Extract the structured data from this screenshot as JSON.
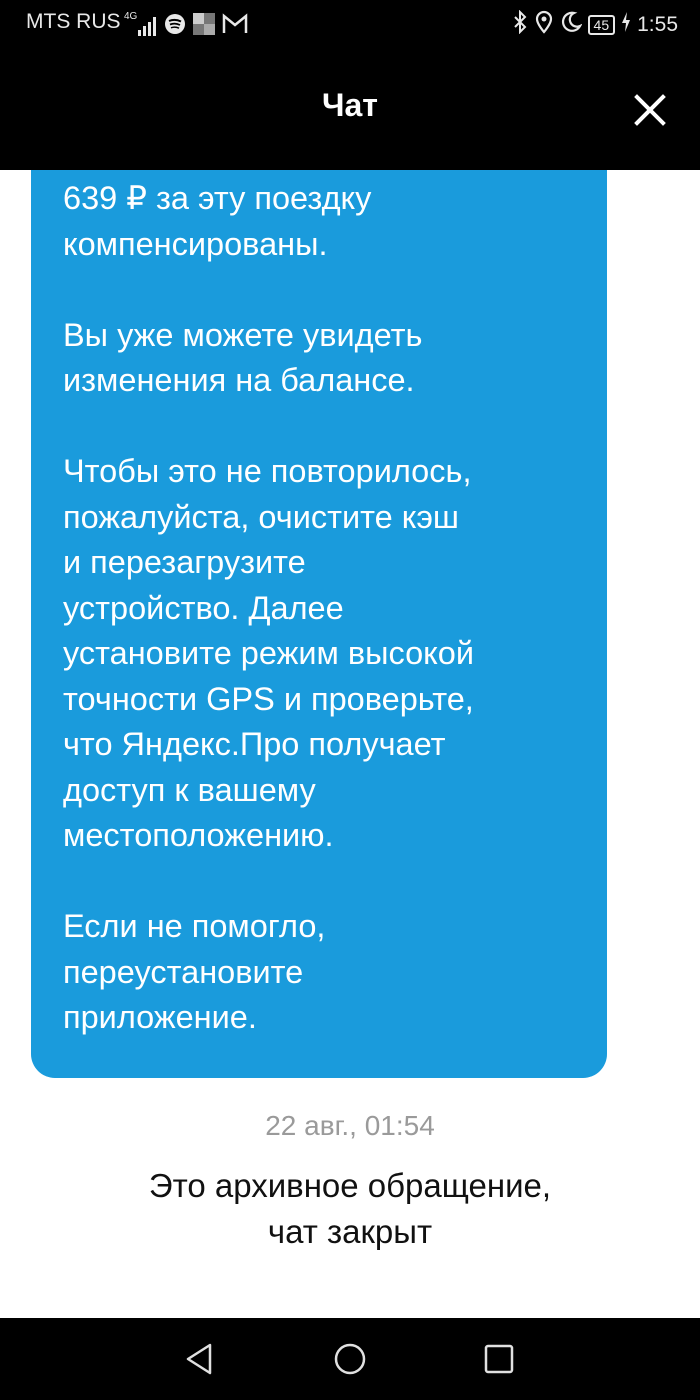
{
  "status_bar": {
    "carrier": "MTS RUS",
    "network": "4G",
    "battery": "45",
    "time": "1:55",
    "icons": [
      "signal-icon",
      "spotify-icon",
      "app-icon",
      "gmail-icon",
      "bluetooth-icon",
      "location-icon",
      "moon-icon",
      "battery-icon",
      "charging-icon"
    ]
  },
  "header": {
    "title": "Чат",
    "close_icon": "close-icon"
  },
  "message": {
    "text": "639 ₽ за эту поездку\nкомпенсированы.\n\nВы уже можете увидеть\nизменения на балансе.\n\nЧтобы это не повторилось,\nпожалуйста, очистите кэш\nи перезагрузите\nустройство. Далее\nустановите режим высокой\nточности GPS и проверьте,\nчто Яндекс.Про получает\nдоступ к вашему\nместоположению.\n\nЕсли не помогло,\nпереустановите\nприложение.",
    "timestamp": "22 авг., 01:54",
    "bubble_color": "#1a9bdc"
  },
  "archive_note": "Это архивное обращение,\nчат закрыт",
  "nav_bar": {
    "icons": [
      "back-icon",
      "home-icon",
      "recents-icon"
    ]
  }
}
